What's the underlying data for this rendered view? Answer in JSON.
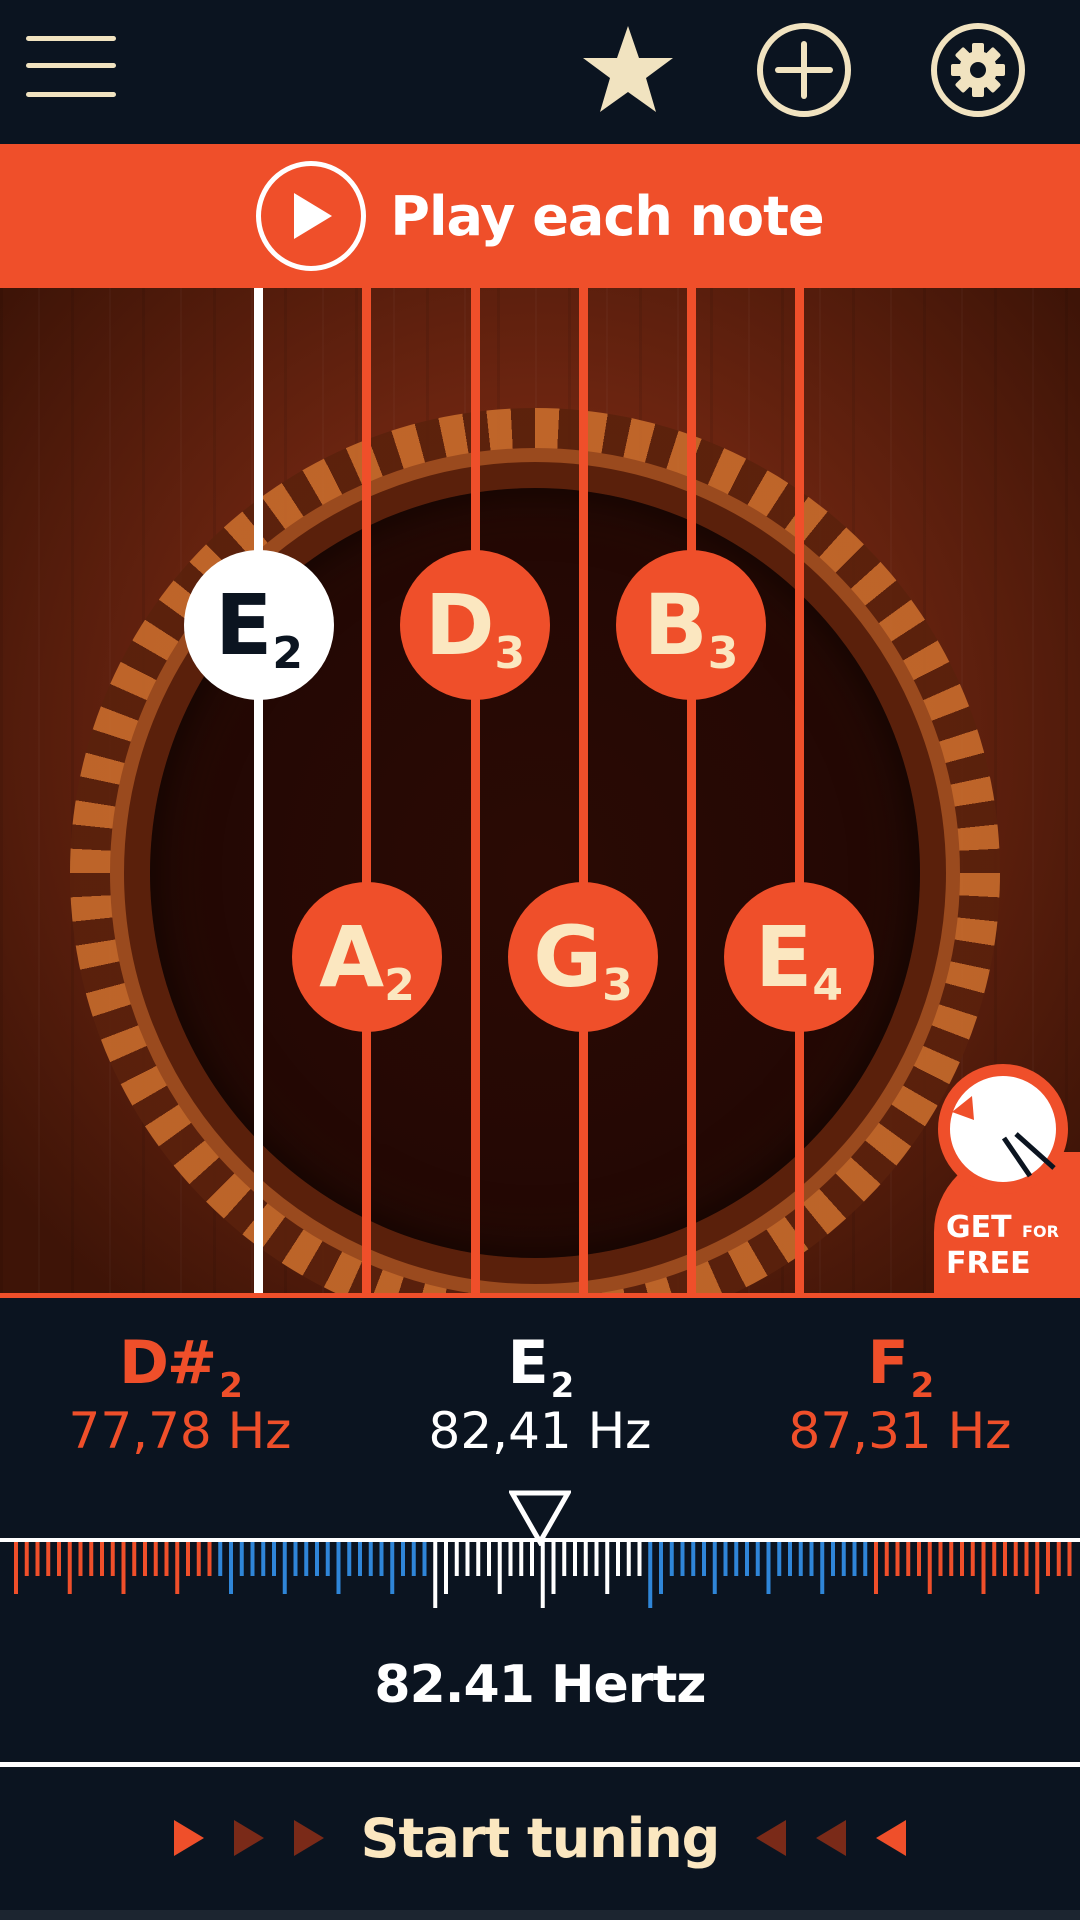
{
  "toolbar": {
    "menu_icon": "hamburger-menu-icon",
    "favorite_icon": "star-icon",
    "add_icon": "plus-circle-icon",
    "settings_icon": "gear-icon"
  },
  "play_banner": {
    "label": "Play each note",
    "icon": "play-circle-icon"
  },
  "strings": [
    {
      "letter": "E",
      "octave": "2",
      "active": true
    },
    {
      "letter": "A",
      "octave": "2",
      "active": false
    },
    {
      "letter": "D",
      "octave": "3",
      "active": false
    },
    {
      "letter": "G",
      "octave": "3",
      "active": false
    },
    {
      "letter": "B",
      "octave": "3",
      "active": false
    },
    {
      "letter": "E",
      "octave": "4",
      "active": false
    }
  ],
  "promo": {
    "line1": "GET",
    "line1_small": "FOR",
    "line2": "FREE"
  },
  "note_info": {
    "left": {
      "note": "D#",
      "octave": "2",
      "hz": "77,78 Hz"
    },
    "center": {
      "note": "E",
      "octave": "2",
      "hz": "82,41 Hz"
    },
    "right": {
      "note": "F",
      "octave": "2",
      "hz": "87,31 Hz"
    }
  },
  "readout": "82.41 Hertz",
  "start_tuning": {
    "label": "Start tuning"
  },
  "colors": {
    "accent": "#ef4f2a",
    "background": "#0b1420",
    "cream": "#fbe7c0",
    "blue_ticks": "#2f86d8",
    "white": "#ffffff"
  }
}
